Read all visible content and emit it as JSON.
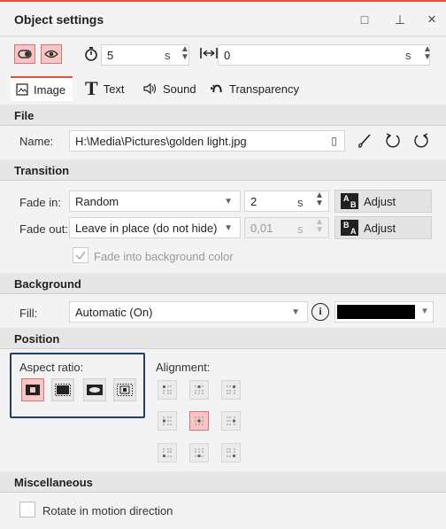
{
  "window": {
    "title": "Object settings",
    "restore_icon": "□",
    "pin_icon": "⊥",
    "close_icon": "×"
  },
  "toolbar": {
    "duration_value": "5",
    "duration_unit": "s",
    "offset_value": "0",
    "offset_unit": "s"
  },
  "tabs": [
    {
      "label": "Image",
      "icon": "image-icon",
      "active": true
    },
    {
      "label": "Text",
      "icon": "text-icon",
      "active": false
    },
    {
      "label": "Sound",
      "icon": "speaker-icon",
      "active": false
    },
    {
      "label": "Transparency",
      "icon": "transparency-icon",
      "active": false
    }
  ],
  "sections": {
    "file": "File",
    "transition": "Transition",
    "background": "Background",
    "position": "Position",
    "misc": "Miscellaneous"
  },
  "file": {
    "name_label": "Name:",
    "name_value": "H:\\Media\\Pictures\\golden light.jpg"
  },
  "transition": {
    "fade_in_label": "Fade in:",
    "fade_in_value": "Random",
    "fade_in_duration": "2",
    "fade_in_unit": "s",
    "fade_in_adjust": "Adjust",
    "fade_out_label": "Fade out:",
    "fade_out_value": "Leave in place (do not hide)",
    "fade_out_duration": "0,01",
    "fade_out_unit": "s",
    "fade_out_adjust": "Adjust",
    "fade_bg_label": "Fade into background color",
    "fade_bg_checked": true
  },
  "background": {
    "fill_label": "Fill:",
    "fill_value": "Automatic (On)",
    "fill_color": "#000000"
  },
  "position": {
    "aspect_label": "Aspect ratio:",
    "alignment_label": "Alignment:"
  },
  "misc": {
    "rotate_label": "Rotate in motion direction",
    "rotate_checked": false
  },
  "colors": {
    "accent": "#e74c3c",
    "active_bg": "#f5c6c6",
    "focus_border": "#1f3f66"
  }
}
